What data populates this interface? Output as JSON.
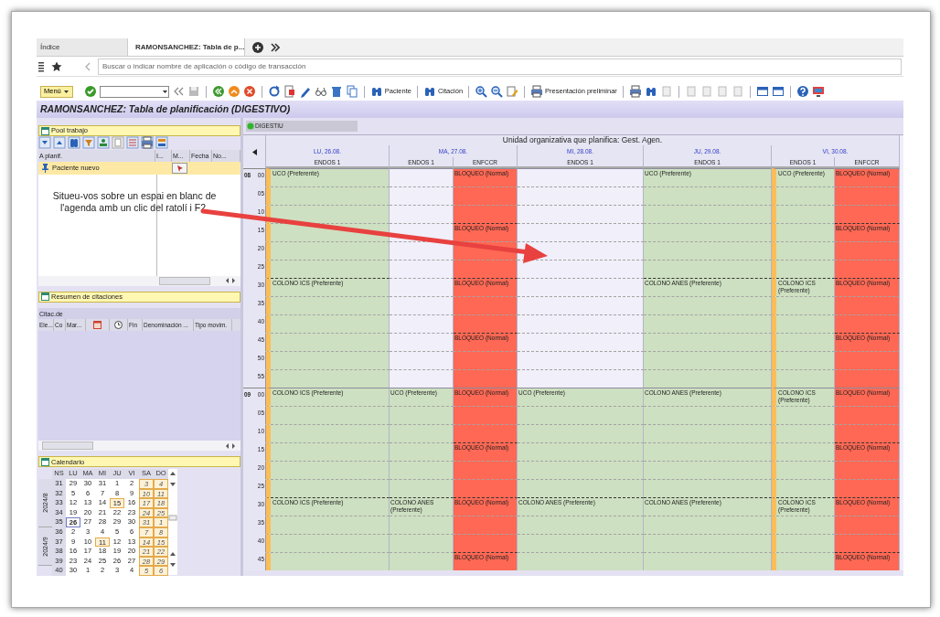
{
  "tabs": [
    {
      "label": "Índice",
      "selected": false
    },
    {
      "label": "RAMONSANCHEZ: Tabla de p...",
      "selected": true
    }
  ],
  "command_field": {
    "placeholder": "Buscar o indicar nombre de aplicación o código de transacción"
  },
  "toolbar": {
    "menu": "Menú",
    "buttons": [
      "Paciente",
      "Citación",
      "Presentación preliminar"
    ]
  },
  "title": "RAMONSANCHEZ: Tabla de planificación (DIGESTIVO)",
  "pool": {
    "title": "Pool trabajo",
    "columns": [
      "A planif.",
      "I...",
      "M...",
      "Fecha",
      "No..."
    ],
    "rows": [
      {
        "label": "Paciente nuevo",
        "selected": true
      }
    ],
    "note": "Situeu-vos sobre un espai en blanc de l'agenda amb un clic del ratolí i F2."
  },
  "summary": {
    "title": "Resumen de citaciones",
    "subtitle": "Citac.de",
    "columns": [
      {
        "kind": "text",
        "label": "Ele..."
      },
      {
        "kind": "text",
        "label": "Co"
      },
      {
        "kind": "text",
        "label": "Mar..."
      },
      {
        "kind": "calendar"
      },
      {
        "kind": "clock"
      },
      {
        "kind": "text",
        "label": "Fin"
      },
      {
        "kind": "text",
        "label": "Denominación ..."
      },
      {
        "kind": "text",
        "label": "Tipo movim."
      }
    ]
  },
  "calendar": {
    "title": "Calendario",
    "headers": [
      "NS",
      "LU",
      "MA",
      "MI",
      "JU",
      "VI",
      "SA",
      "DO"
    ],
    "months": [
      {
        "label": "2024/8",
        "weeks": [
          {
            "no": "31",
            "days": [
              {
                "d": "29",
                "kind": "work",
                "selected": false
              },
              {
                "d": "30",
                "kind": "work",
                "selected": false
              },
              {
                "d": "31",
                "kind": "work",
                "selected": false
              },
              {
                "d": "1",
                "kind": "work",
                "selected": false
              },
              {
                "d": "2",
                "kind": "work",
                "selected": false
              },
              {
                "d": "3",
                "kind": "weekend",
                "selected": false
              },
              {
                "d": "4",
                "kind": "weekend",
                "selected": false
              }
            ]
          },
          {
            "no": "32",
            "days": [
              {
                "d": "5",
                "kind": "work",
                "selected": false
              },
              {
                "d": "6",
                "kind": "work",
                "selected": false
              },
              {
                "d": "7",
                "kind": "work",
                "selected": false
              },
              {
                "d": "8",
                "kind": "work",
                "selected": false
              },
              {
                "d": "9",
                "kind": "work",
                "selected": false
              },
              {
                "d": "10",
                "kind": "weekend",
                "selected": false
              },
              {
                "d": "11",
                "kind": "weekend",
                "selected": false
              }
            ]
          },
          {
            "no": "33",
            "days": [
              {
                "d": "12",
                "kind": "work",
                "selected": false
              },
              {
                "d": "13",
                "kind": "work",
                "selected": false
              },
              {
                "d": "14",
                "kind": "work",
                "selected": false
              },
              {
                "d": "15",
                "kind": "holiday",
                "selected": false
              },
              {
                "d": "16",
                "kind": "work",
                "selected": false
              },
              {
                "d": "17",
                "kind": "weekend",
                "selected": false
              },
              {
                "d": "18",
                "kind": "weekend",
                "selected": false
              }
            ]
          },
          {
            "no": "34",
            "days": [
              {
                "d": "19",
                "kind": "work",
                "selected": false
              },
              {
                "d": "20",
                "kind": "work",
                "selected": false
              },
              {
                "d": "21",
                "kind": "work",
                "selected": false
              },
              {
                "d": "22",
                "kind": "work",
                "selected": false
              },
              {
                "d": "23",
                "kind": "work",
                "selected": false
              },
              {
                "d": "24",
                "kind": "weekend",
                "selected": false
              },
              {
                "d": "25",
                "kind": "weekend",
                "selected": false
              }
            ]
          },
          {
            "no": "35",
            "days": [
              {
                "d": "26",
                "kind": "work",
                "selected": true
              },
              {
                "d": "27",
                "kind": "work",
                "selected": false
              },
              {
                "d": "28",
                "kind": "work",
                "selected": false
              },
              {
                "d": "29",
                "kind": "work",
                "selected": false
              },
              {
                "d": "30",
                "kind": "work",
                "selected": false
              },
              {
                "d": "31",
                "kind": "weekend",
                "selected": false
              },
              {
                "d": "1",
                "kind": "weekend",
                "selected": false
              }
            ]
          }
        ]
      },
      {
        "label": "2024/9",
        "weeks": [
          {
            "no": "36",
            "days": [
              {
                "d": "2",
                "kind": "work",
                "selected": false
              },
              {
                "d": "3",
                "kind": "work",
                "selected": false
              },
              {
                "d": "4",
                "kind": "work",
                "selected": false
              },
              {
                "d": "5",
                "kind": "work",
                "selected": false
              },
              {
                "d": "6",
                "kind": "work",
                "selected": false
              },
              {
                "d": "7",
                "kind": "weekend",
                "selected": false
              },
              {
                "d": "8",
                "kind": "weekend",
                "selected": false
              }
            ]
          },
          {
            "no": "37",
            "days": [
              {
                "d": "9",
                "kind": "work",
                "selected": false
              },
              {
                "d": "10",
                "kind": "work",
                "selected": false
              },
              {
                "d": "11",
                "kind": "holiday",
                "selected": false
              },
              {
                "d": "12",
                "kind": "work",
                "selected": false
              },
              {
                "d": "13",
                "kind": "work",
                "selected": false
              },
              {
                "d": "14",
                "kind": "weekend",
                "selected": false
              },
              {
                "d": "15",
                "kind": "weekend",
                "selected": false
              }
            ]
          },
          {
            "no": "38",
            "days": [
              {
                "d": "16",
                "kind": "work",
                "selected": false
              },
              {
                "d": "17",
                "kind": "work",
                "selected": false
              },
              {
                "d": "18",
                "kind": "work",
                "selected": false
              },
              {
                "d": "19",
                "kind": "work",
                "selected": false
              },
              {
                "d": "20",
                "kind": "work",
                "selected": false
              },
              {
                "d": "21",
                "kind": "weekend",
                "selected": false
              },
              {
                "d": "22",
                "kind": "weekend",
                "selected": false
              }
            ]
          },
          {
            "no": "39",
            "days": [
              {
                "d": "23",
                "kind": "work",
                "selected": false
              },
              {
                "d": "24",
                "kind": "work",
                "selected": false
              },
              {
                "d": "25",
                "kind": "work",
                "selected": false
              },
              {
                "d": "26",
                "kind": "work",
                "selected": false
              },
              {
                "d": "27",
                "kind": "work",
                "selected": false
              },
              {
                "d": "28",
                "kind": "weekend",
                "selected": false
              },
              {
                "d": "29",
                "kind": "weekend",
                "selected": false
              }
            ]
          }
        ]
      },
      {
        "weeks": [
          {
            "no": "40",
            "days": [
              {
                "d": "30",
                "kind": "work",
                "selected": false
              },
              {
                "d": "1",
                "kind": "work",
                "selected": false
              },
              {
                "d": "2",
                "kind": "work",
                "selected": false
              },
              {
                "d": "3",
                "kind": "work",
                "selected": false
              },
              {
                "d": "4",
                "kind": "work",
                "selected": false
              },
              {
                "d": "5",
                "kind": "weekend",
                "selected": false
              },
              {
                "d": "6",
                "kind": "weekend",
                "selected": false
              }
            ]
          }
        ]
      }
    ]
  },
  "schedule": {
    "unit": "DIGESTIU",
    "org_label": "Unidad organizativa que planifica: Gest. Agen.",
    "days": [
      {
        "label": "LU, 26.08.",
        "resources": [
          {
            "label": "ENDOS 1",
            "marked": true
          }
        ]
      },
      {
        "label": "MA, 27.08.",
        "resources": [
          {
            "label": "ENDOS 1",
            "marked": false
          },
          {
            "label": "ENFCCR",
            "marked": false
          }
        ]
      },
      {
        "label": "MI, 28.08.",
        "resources": [
          {
            "label": "ENDOS 1",
            "marked": false
          }
        ]
      },
      {
        "label": "JU, 29.08.",
        "resources": [
          {
            "label": "ENDOS 1",
            "marked": false
          }
        ]
      },
      {
        "label": "VI, 30.08.",
        "resources": [
          {
            "label": "ENDOS 1",
            "marked": true
          },
          {
            "label": "ENFCCR",
            "marked": false
          }
        ]
      }
    ],
    "rows": [
      {
        "hour": "08",
        "minute": "00",
        "cells": [
          {
            "kind": "booked",
            "text": "UCO (Preferente)"
          },
          {
            "kind": "free"
          },
          {
            "kind": "blocked",
            "text": "BLOQUEO (Normal)"
          },
          {
            "kind": "free"
          },
          {
            "kind": "booked",
            "text": "UCO (Preferente)"
          },
          {
            "kind": "booked",
            "text": "UCO (Preferente)"
          },
          {
            "kind": "blocked",
            "text": "BLOQUEO (Normal)"
          }
        ]
      },
      {
        "minute": "05",
        "cells": [
          {
            "kind": "booked"
          },
          {
            "kind": "free"
          },
          {
            "kind": "blocked"
          },
          {
            "kind": "free"
          },
          {
            "kind": "booked"
          },
          {
            "kind": "booked"
          },
          {
            "kind": "blocked"
          }
        ]
      },
      {
        "minute": "10",
        "cells": [
          {
            "kind": "booked"
          },
          {
            "kind": "free"
          },
          {
            "kind": "blocked"
          },
          {
            "kind": "free"
          },
          {
            "kind": "booked"
          },
          {
            "kind": "booked"
          },
          {
            "kind": "blocked"
          }
        ]
      },
      {
        "minute": "15",
        "cells": [
          {
            "kind": "booked"
          },
          {
            "kind": "free"
          },
          {
            "kind": "blocked",
            "text": "BLOQUEO (Normal)"
          },
          {
            "kind": "free"
          },
          {
            "kind": "booked"
          },
          {
            "kind": "booked"
          },
          {
            "kind": "blocked",
            "text": "BLOQUEO (Normal)"
          }
        ]
      },
      {
        "minute": "20",
        "cells": [
          {
            "kind": "booked"
          },
          {
            "kind": "free"
          },
          {
            "kind": "blocked"
          },
          {
            "kind": "free"
          },
          {
            "kind": "booked"
          },
          {
            "kind": "booked"
          },
          {
            "kind": "blocked"
          }
        ]
      },
      {
        "minute": "25",
        "cells": [
          {
            "kind": "booked"
          },
          {
            "kind": "free"
          },
          {
            "kind": "blocked"
          },
          {
            "kind": "free"
          },
          {
            "kind": "booked"
          },
          {
            "kind": "booked"
          },
          {
            "kind": "blocked"
          }
        ]
      },
      {
        "minute": "30",
        "cells": [
          {
            "kind": "booked",
            "text": "COLONO ICS (Preferente)"
          },
          {
            "kind": "free"
          },
          {
            "kind": "blocked",
            "text": "BLOQUEO (Normal)"
          },
          {
            "kind": "free"
          },
          {
            "kind": "booked",
            "text": "COLONO ANES (Preferente)"
          },
          {
            "kind": "booked",
            "text": "COLONO ICS (Preferente)"
          },
          {
            "kind": "blocked",
            "text": "BLOQUEO (Normal)"
          }
        ]
      },
      {
        "minute": "35",
        "cells": [
          {
            "kind": "booked"
          },
          {
            "kind": "free"
          },
          {
            "kind": "blocked"
          },
          {
            "kind": "free"
          },
          {
            "kind": "booked"
          },
          {
            "kind": "booked"
          },
          {
            "kind": "blocked"
          }
        ]
      },
      {
        "minute": "40",
        "cells": [
          {
            "kind": "booked"
          },
          {
            "kind": "free"
          },
          {
            "kind": "blocked"
          },
          {
            "kind": "free"
          },
          {
            "kind": "booked"
          },
          {
            "kind": "booked"
          },
          {
            "kind": "blocked"
          }
        ]
      },
      {
        "minute": "45",
        "cells": [
          {
            "kind": "booked"
          },
          {
            "kind": "free"
          },
          {
            "kind": "blocked",
            "text": "BLOQUEO (Normal)"
          },
          {
            "kind": "free"
          },
          {
            "kind": "booked"
          },
          {
            "kind": "booked"
          },
          {
            "kind": "blocked",
            "text": "BLOQUEO (Normal)"
          }
        ]
      },
      {
        "minute": "50",
        "cells": [
          {
            "kind": "booked"
          },
          {
            "kind": "free"
          },
          {
            "kind": "blocked"
          },
          {
            "kind": "free"
          },
          {
            "kind": "booked"
          },
          {
            "kind": "booked"
          },
          {
            "kind": "blocked"
          }
        ]
      },
      {
        "minute": "55",
        "cells": [
          {
            "kind": "booked"
          },
          {
            "kind": "free"
          },
          {
            "kind": "blocked"
          },
          {
            "kind": "free"
          },
          {
            "kind": "booked"
          },
          {
            "kind": "booked"
          },
          {
            "kind": "blocked"
          }
        ]
      },
      {
        "hour": "09",
        "minute": "00",
        "cells": [
          {
            "kind": "booked",
            "text": "COLONO ICS (Preferente)"
          },
          {
            "kind": "booked",
            "text": "UCO (Preferente)"
          },
          {
            "kind": "blocked",
            "text": "BLOQUEO (Normal)"
          },
          {
            "kind": "booked",
            "text": "UCO (Preferente)"
          },
          {
            "kind": "booked",
            "text": "COLONO ANES (Preferente)"
          },
          {
            "kind": "booked",
            "text": "COLONO ICS (Preferente)"
          },
          {
            "kind": "blocked",
            "text": "BLOQUEO (Normal)"
          }
        ]
      },
      {
        "minute": "05",
        "cells": [
          {
            "kind": "booked"
          },
          {
            "kind": "booked"
          },
          {
            "kind": "blocked"
          },
          {
            "kind": "booked"
          },
          {
            "kind": "booked"
          },
          {
            "kind": "booked"
          },
          {
            "kind": "blocked"
          }
        ]
      },
      {
        "minute": "10",
        "cells": [
          {
            "kind": "booked"
          },
          {
            "kind": "booked"
          },
          {
            "kind": "blocked"
          },
          {
            "kind": "booked"
          },
          {
            "kind": "booked"
          },
          {
            "kind": "booked"
          },
          {
            "kind": "blocked"
          }
        ]
      },
      {
        "minute": "15",
        "cells": [
          {
            "kind": "booked"
          },
          {
            "kind": "booked"
          },
          {
            "kind": "blocked",
            "text": "BLOQUEO (Normal)"
          },
          {
            "kind": "booked"
          },
          {
            "kind": "booked"
          },
          {
            "kind": "booked"
          },
          {
            "kind": "blocked",
            "text": "BLOQUEO (Normal)"
          }
        ]
      },
      {
        "minute": "20",
        "cells": [
          {
            "kind": "booked"
          },
          {
            "kind": "booked"
          },
          {
            "kind": "blocked"
          },
          {
            "kind": "booked"
          },
          {
            "kind": "booked"
          },
          {
            "kind": "booked"
          },
          {
            "kind": "blocked"
          }
        ]
      },
      {
        "minute": "25",
        "cells": [
          {
            "kind": "booked"
          },
          {
            "kind": "booked"
          },
          {
            "kind": "blocked"
          },
          {
            "kind": "booked"
          },
          {
            "kind": "booked"
          },
          {
            "kind": "booked"
          },
          {
            "kind": "blocked"
          }
        ]
      },
      {
        "minute": "30",
        "cells": [
          {
            "kind": "booked",
            "text": "COLONO ICS (Preferente)"
          },
          {
            "kind": "booked",
            "text": "COLONO ANES (Preferente)"
          },
          {
            "kind": "blocked",
            "text": "BLOQUEO (Normal)"
          },
          {
            "kind": "booked",
            "text": "COLONO ANES (Preferente)"
          },
          {
            "kind": "booked",
            "text": "COLONO ANES (Preferente)"
          },
          {
            "kind": "booked",
            "text": "COLONO ICS (Preferente)"
          },
          {
            "kind": "blocked",
            "text": "BLOQUEO (Normal)"
          }
        ]
      },
      {
        "minute": "35",
        "cells": [
          {
            "kind": "booked"
          },
          {
            "kind": "booked"
          },
          {
            "kind": "blocked"
          },
          {
            "kind": "booked"
          },
          {
            "kind": "booked"
          },
          {
            "kind": "booked"
          },
          {
            "kind": "blocked"
          }
        ]
      },
      {
        "minute": "40",
        "cells": [
          {
            "kind": "booked"
          },
          {
            "kind": "booked"
          },
          {
            "kind": "blocked"
          },
          {
            "kind": "booked"
          },
          {
            "kind": "booked"
          },
          {
            "kind": "booked"
          },
          {
            "kind": "blocked"
          }
        ]
      },
      {
        "minute": "45",
        "cells": [
          {
            "kind": "booked"
          },
          {
            "kind": "booked"
          },
          {
            "kind": "blocked",
            "text": "BLOQUEO (Normal)"
          },
          {
            "kind": "booked"
          },
          {
            "kind": "booked"
          },
          {
            "kind": "booked"
          },
          {
            "kind": "blocked",
            "text": "BLOQUEO (Normal)"
          }
        ]
      }
    ]
  }
}
